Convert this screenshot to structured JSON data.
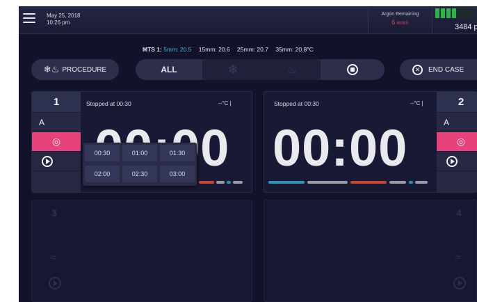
{
  "header": {
    "date": "May 25, 2018",
    "time": "10:26 pm",
    "argon_label": "Argon Remaining",
    "argon_value": "6",
    "argon_unit": "MINS",
    "tank_value": "3484 p"
  },
  "temps": {
    "prefix": "MTS 1:",
    "t5": "5mm: 20.5",
    "t15": "15mm: 20.6",
    "t25": "25mm: 20.7",
    "t35": "35mm: 20.8°C"
  },
  "controls": {
    "procedure_label": "PROCEDURE",
    "all_label": "ALL",
    "end_case_label": "END CASE"
  },
  "probes": [
    {
      "number": "1",
      "mode": "A",
      "status": "Stopped at 00:30",
      "temp": "--°C |",
      "timer": "00:00"
    },
    {
      "number": "2",
      "mode": "A",
      "status": "Stopped at 00:30",
      "temp": "--°C |",
      "timer": "00:00"
    },
    {
      "number": "3"
    },
    {
      "number": "4"
    }
  ],
  "picker": {
    "options": [
      "00:30",
      "01:00",
      "01:30",
      "02:00",
      "02:30",
      "03:00"
    ]
  },
  "colors": {
    "accent_pink": "#e7427c",
    "argon_red": "#e9475f",
    "temp_blue": "#3cb4cf",
    "tank_green": "#2fb34a",
    "bar_blue": "#2f8fb4",
    "bar_red": "#c8452f",
    "bar_grey": "#9a9aa6"
  }
}
